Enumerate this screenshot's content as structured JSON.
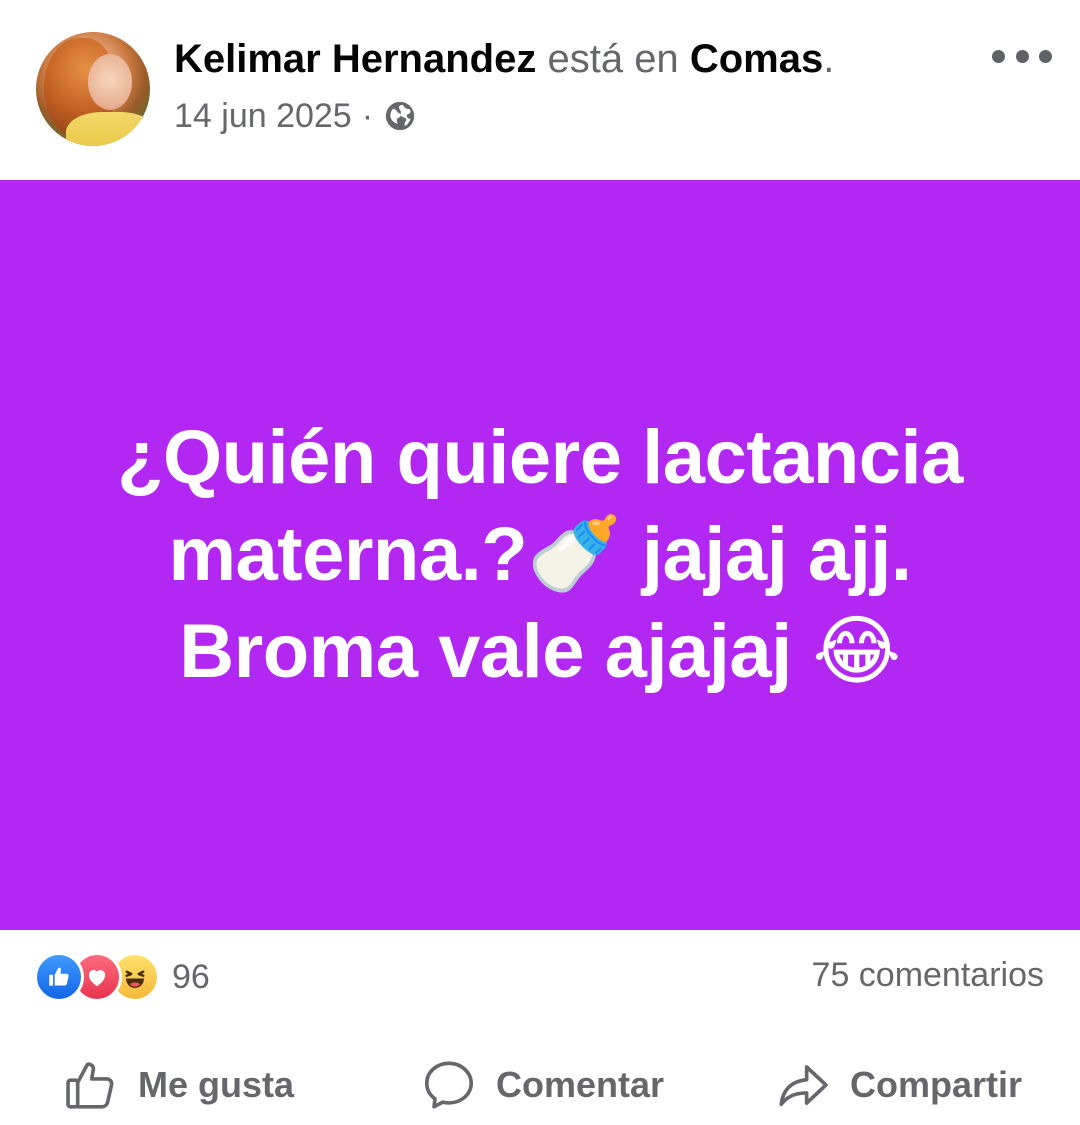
{
  "post": {
    "author": "Kelimar Hernandez",
    "location_prefix": "está en",
    "location": "Comas",
    "location_suffix": ".",
    "date": "14 jun 2025",
    "date_separator": "·",
    "privacy_icon": "globe-icon",
    "more_icon": "more-dots-icon"
  },
  "status": {
    "line1": "¿Quién quiere lactancia",
    "line2_text": "materna.?",
    "line2_emoji": "🍼",
    "line2_rest": " jajaj ajj.",
    "line3_text": "Broma vale ajajaj ",
    "line3_emoji": "😂",
    "background_color": "#b227f2"
  },
  "engagement": {
    "reaction_icons": [
      "like-reaction-icon",
      "love-reaction-icon",
      "haha-reaction-icon"
    ],
    "reaction_count": "96",
    "comments": "75 comentarios"
  },
  "actions": {
    "like_label": "Me gusta",
    "comment_label": "Comentar",
    "share_label": "Compartir"
  }
}
